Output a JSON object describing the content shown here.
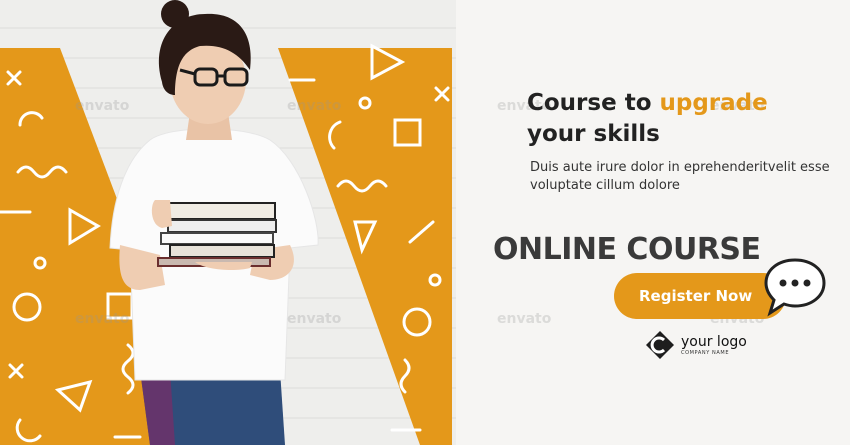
{
  "headline": {
    "before": "Course to ",
    "accent": "upgrade",
    "line2": "your skills"
  },
  "description": "Duis aute irure dolor in eprehenderitvelit esse voluptate cillum dolore",
  "title": "ONLINE COURSE",
  "cta": {
    "label": "Register Now"
  },
  "logo": {
    "name": "your logo",
    "tagline": "COMPANY NAME"
  },
  "watermark": "envato",
  "colors": {
    "accent": "#e4981a",
    "background": "#f6f5f3",
    "dark_text": "#222222"
  }
}
